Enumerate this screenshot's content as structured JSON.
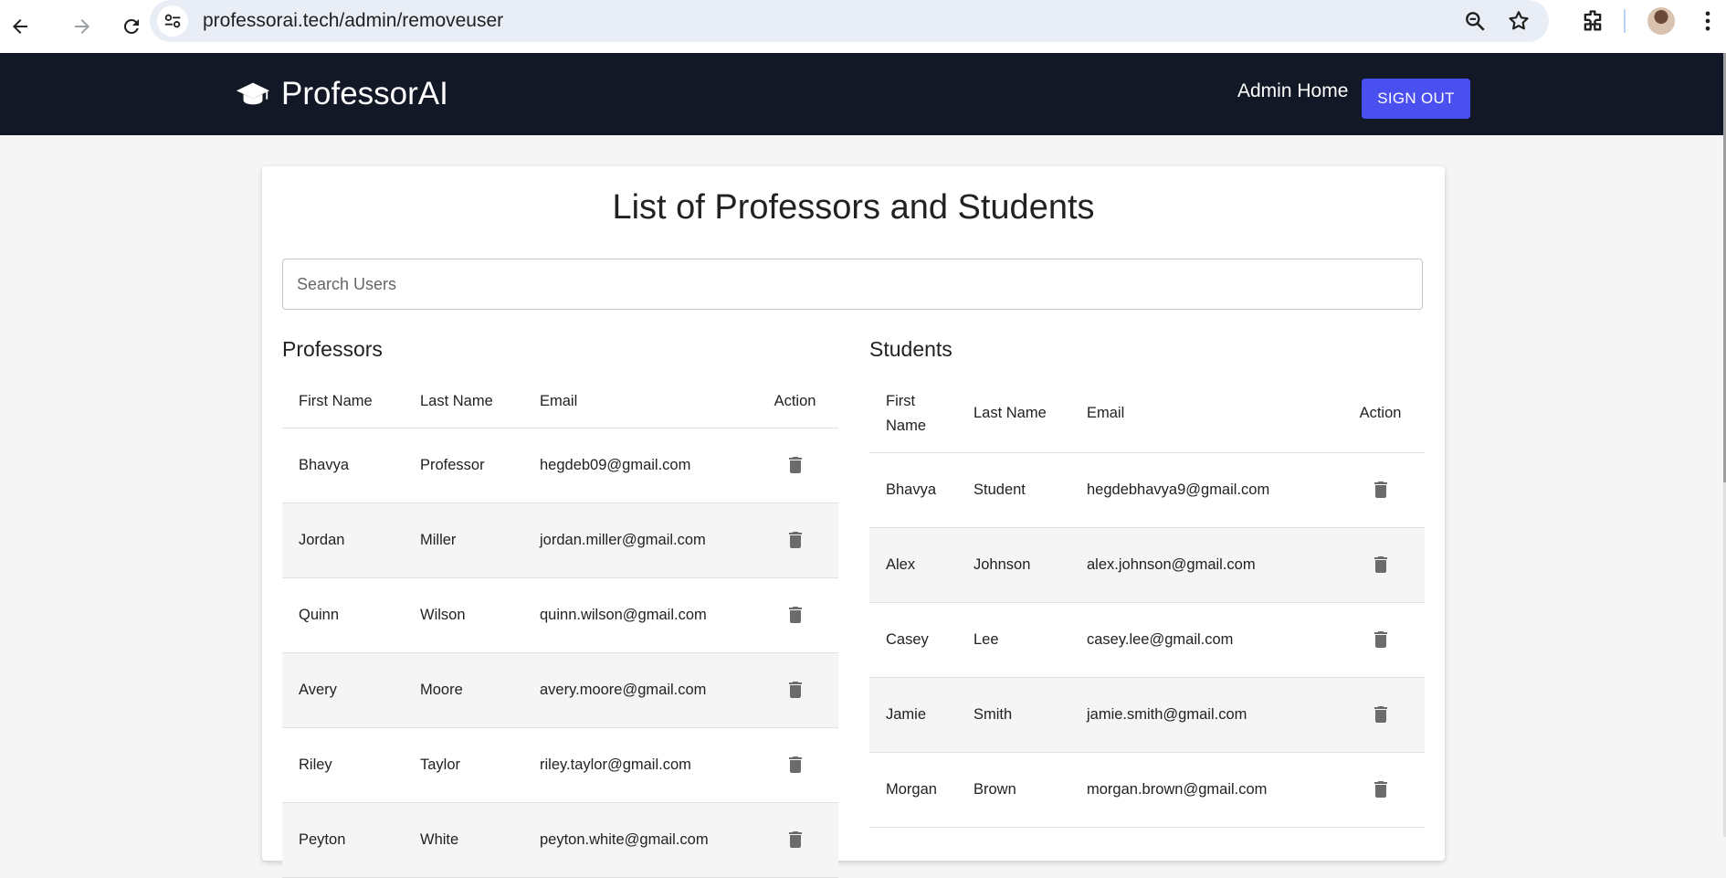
{
  "browser": {
    "url": "professorai.tech/admin/removeuser"
  },
  "header": {
    "brand": "ProfessorAI",
    "admin_home": "Admin Home",
    "sign_out": "SIGN OUT"
  },
  "main": {
    "title": "List of Professors and Students",
    "search_placeholder": "Search Users",
    "professors": {
      "title": "Professors",
      "columns": [
        "First Name",
        "Last Name",
        "Email",
        "Action"
      ],
      "rows": [
        {
          "first": "Bhavya",
          "last": "Professor",
          "email": "hegdeb09@gmail.com"
        },
        {
          "first": "Jordan",
          "last": "Miller",
          "email": "jordan.miller@gmail.com"
        },
        {
          "first": "Quinn",
          "last": "Wilson",
          "email": "quinn.wilson@gmail.com"
        },
        {
          "first": "Avery",
          "last": "Moore",
          "email": "avery.moore@gmail.com"
        },
        {
          "first": "Riley",
          "last": "Taylor",
          "email": "riley.taylor@gmail.com"
        },
        {
          "first": "Peyton",
          "last": "White",
          "email": "peyton.white@gmail.com"
        }
      ]
    },
    "students": {
      "title": "Students",
      "columns": [
        "First Name",
        "Last Name",
        "Email",
        "Action"
      ],
      "rows": [
        {
          "first": "Bhavya",
          "last": "Student",
          "email": "hegdebhavya9@gmail.com"
        },
        {
          "first": "Alex",
          "last": "Johnson",
          "email": "alex.johnson@gmail.com"
        },
        {
          "first": "Casey",
          "last": "Lee",
          "email": "casey.lee@gmail.com"
        },
        {
          "first": "Jamie",
          "last": "Smith",
          "email": "jamie.smith@gmail.com"
        },
        {
          "first": "Morgan",
          "last": "Brown",
          "email": "morgan.brown@gmail.com"
        }
      ]
    }
  },
  "colors": {
    "appbar": "#121826",
    "accent": "#4a4ff0",
    "trash": "#6b6b6b"
  }
}
